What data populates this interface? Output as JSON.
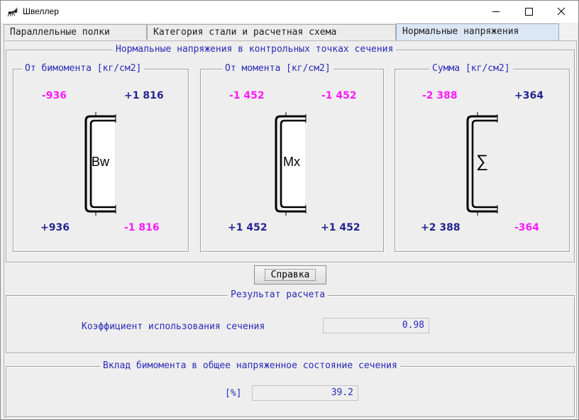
{
  "window": {
    "title": "Швеллер",
    "icon": "ant-icon",
    "controls": [
      "minimize-icon",
      "maximize-icon",
      "close-icon"
    ]
  },
  "tabs": [
    {
      "label": "Параллельные полки",
      "active": false
    },
    {
      "label": "Категория стали и расчетная схема",
      "active": false
    },
    {
      "label": "Нормальные напряжения",
      "active": true
    }
  ],
  "stresses": {
    "title": "Нормальные напряжения в контрольных точках сечения",
    "panels": [
      {
        "title": "От бимомента [кг/см2]",
        "symbol": "Bw",
        "top_left": "-936",
        "top_right": "+1 816",
        "bottom_left": "+936",
        "bottom_right": "-1 816"
      },
      {
        "title": "От момента [кг/см2]",
        "symbol": "Mx",
        "top_left": "-1 452",
        "top_right": "-1 452",
        "bottom_left": "+1 452",
        "bottom_right": "+1 452"
      },
      {
        "title": "Сумма [кг/см2]",
        "symbol": "∑",
        "top_left": "-2 388",
        "top_right": "+364",
        "bottom_left": "+2 388",
        "bottom_right": "-364"
      }
    ]
  },
  "help_button": "Справка",
  "result": {
    "title": "Результат расчета",
    "label": "Коэффициент использования сечения",
    "value": "0.98"
  },
  "bimoment": {
    "title": "Вклад бимомента в общее напряженное состояние сечения",
    "label": "[%]",
    "value": "39.2"
  },
  "colors": {
    "negative": "#ff1aff",
    "positive": "#25258f",
    "text": "#2a2ab8",
    "active_tab": "#dbe7f5"
  }
}
